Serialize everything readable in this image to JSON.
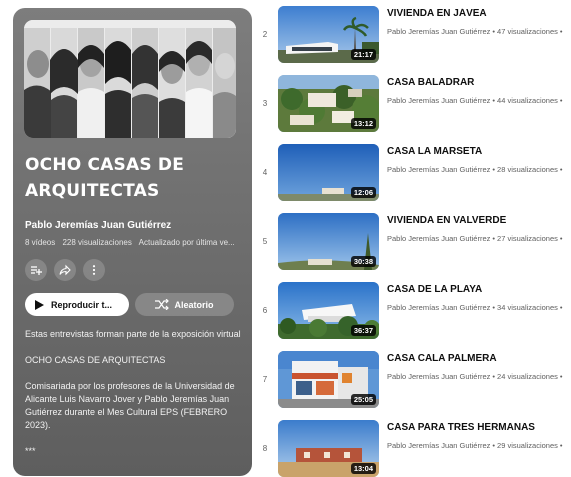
{
  "playlist": {
    "title": "OCHO CASAS DE ARQUITECTAS",
    "owner": "Pablo Jeremías Juan Gutiérrez",
    "video_count": "8 vídeos",
    "views": "228 visualizaciones",
    "updated": "Actualizado por última ve...",
    "play_label": "Reproducir t...",
    "shuffle_label": "Aleatorio",
    "icons": [
      "add-to-queue-icon",
      "share-icon",
      "more-icon",
      "play-icon",
      "shuffle-icon"
    ],
    "description": [
      "Estas entrevistas forman parte de la exposición virtual",
      "OCHO CASAS DE ARQUITECTAS",
      "Comisariada por los profesores de la Universidad de Alicante Luis Navarro Jover y Pablo Jeremías Juan Gutiérrez durante el Mes Cultural EPS (FEBRERO 2023).",
      "***"
    ]
  },
  "videos": [
    {
      "index": "2",
      "title": "VIVIENDA EN JÁVEA",
      "channel": "Pablo Jeremías Juan Gutiérrez",
      "views": "47 visualizaciones",
      "duration": "21:17"
    },
    {
      "index": "3",
      "title": "CASA BALADRAR",
      "channel": "Pablo Jeremías Juan Gutiérrez",
      "views": "44 visualizaciones",
      "duration": "13:12"
    },
    {
      "index": "4",
      "title": "CASA LA MARSETA",
      "channel": "Pablo Jeremías Juan Gutiérrez",
      "views": "28 visualizaciones",
      "duration": "12:06"
    },
    {
      "index": "5",
      "title": "VIVIENDA EN VALVERDE",
      "channel": "Pablo Jeremías Juan Gutiérrez",
      "views": "27 visualizaciones",
      "duration": "30:38"
    },
    {
      "index": "6",
      "title": "CASA DE LA PLAYA",
      "channel": "Pablo Jeremías Juan Gutiérrez",
      "views": "34 visualizaciones",
      "duration": "36:37"
    },
    {
      "index": "7",
      "title": "CASA CALA PALMERA",
      "channel": "Pablo Jeremías Juan Gutiérrez",
      "views": "24 visualizaciones",
      "duration": "25:05"
    },
    {
      "index": "8",
      "title": "CASA PARA TRES HERMANAS",
      "channel": "Pablo Jeremías Juan Gutiérrez",
      "views": "29 visualizaciones",
      "duration": "13:04"
    }
  ],
  "separator": "•"
}
